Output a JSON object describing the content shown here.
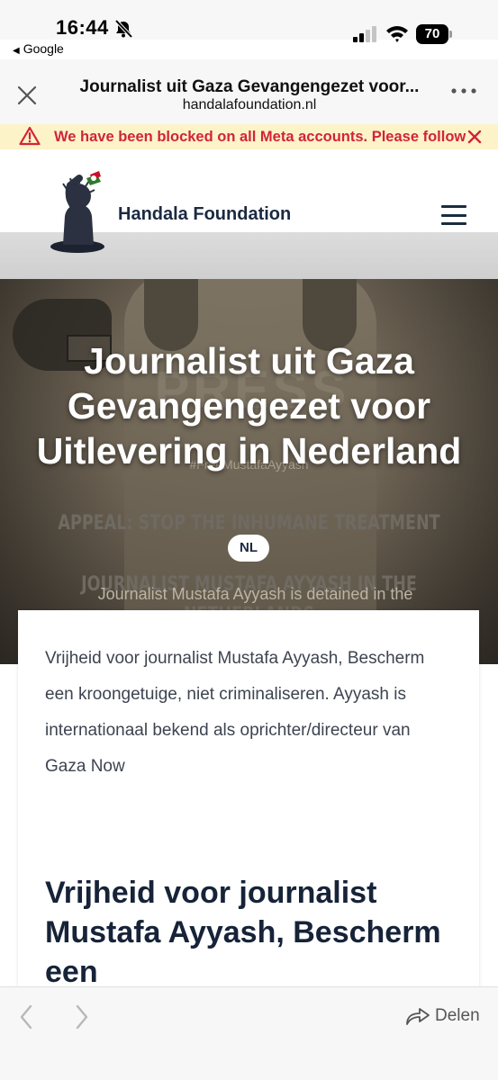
{
  "status_bar": {
    "time": "16:44",
    "back_app": "Google",
    "battery": "70"
  },
  "browser": {
    "page_title": "Journalist uit Gaza Gevangengezet voor...",
    "domain": "handalafoundation.nl"
  },
  "banner": {
    "text": "We have been blocked on all Meta accounts. Please follow"
  },
  "site": {
    "name": "Handala Foundation"
  },
  "hero": {
    "image_text_press": "PRESS",
    "image_text_hashtag": "#FreeMustafaAyyash",
    "title": "Journalist uit Gaza Gevangengezet voor Uitlevering in Nederland",
    "appeal_line1": "APPEAL: STOP THE INHUMANE TREATMENT OF",
    "appeal_line2": "JOURNALIST MUSTAFA AYYASH IN THE NETHERLANDS",
    "language_badge": "NL",
    "subtext": "Journalist Mustafa Ayyash is detained in the"
  },
  "article": {
    "intro": "Vrijheid voor journalist Mustafa Ayyash, Bescherm een kroongetuige, niet criminaliseren. Ayyash is internationaal bekend als oprichter/directeur van Gaza Now",
    "heading": "Vrijheid voor journalist Mustafa Ayyash, Bescherm een"
  },
  "toolbar": {
    "share_label": "Delen"
  },
  "colors": {
    "banner_bg": "#fdf3c8",
    "banner_text": "#d1243a",
    "brand_navy": "#1b2a41"
  }
}
